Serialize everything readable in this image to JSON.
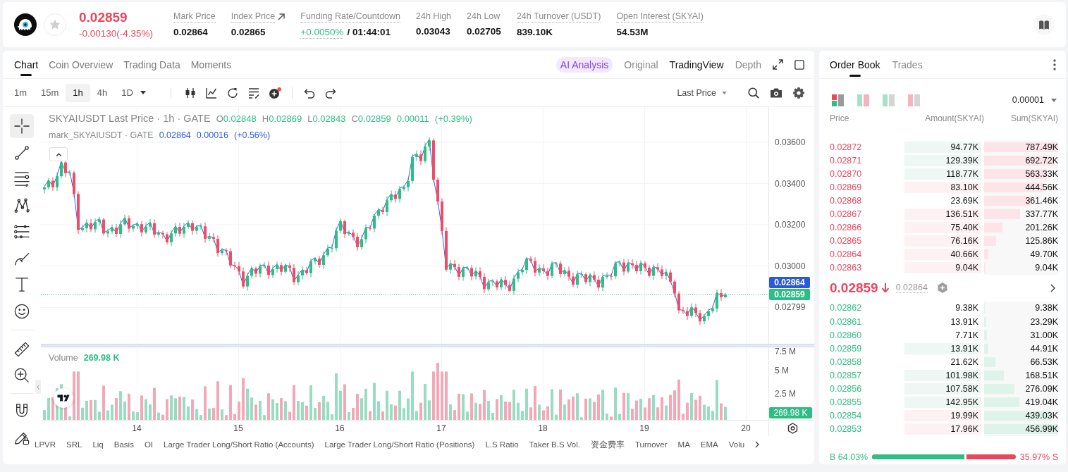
{
  "header": {
    "falling": true,
    "price": "0.02859",
    "change": "-0.00130(-4.35%)",
    "favorite": false,
    "stats": [
      {
        "kind": "plain",
        "label": "Mark Price",
        "tooltip": true,
        "value": "0.02864"
      },
      {
        "kind": "link",
        "label": "Index Price",
        "tooltip": true,
        "value": "0.02865"
      },
      {
        "kind": "funding",
        "label": "Funding Rate/Countdown",
        "tooltip": true,
        "rate": "+0.0050%",
        "countdown": "/ 01:44:01"
      },
      {
        "kind": "plain",
        "label": "24h High",
        "tooltip": false,
        "value": "0.03043"
      },
      {
        "kind": "plain",
        "label": "24h Low",
        "tooltip": false,
        "value": "0.02705"
      },
      {
        "kind": "plain",
        "label": "24h Turnover (USDT)",
        "tooltip": true,
        "value": "839.10K"
      },
      {
        "kind": "plain",
        "label": "Open Interest (SKYAI)",
        "tooltip": true,
        "value": "54.53M"
      }
    ]
  },
  "chart_panel": {
    "tabs": [
      {
        "label": "Chart",
        "selected": true
      },
      {
        "label": "Coin Overview",
        "selected": false
      },
      {
        "label": "Trading Data",
        "selected": false
      },
      {
        "label": "Moments",
        "selected": false
      }
    ],
    "views": [
      {
        "kind": "ai",
        "label": "AI Analysis",
        "selected": false
      },
      {
        "kind": "text",
        "label": "Original",
        "selected": false
      },
      {
        "kind": "text",
        "label": "TradingView",
        "selected": true
      },
      {
        "kind": "text",
        "label": "Depth",
        "selected": false
      }
    ],
    "intervals": [
      {
        "kind": "button",
        "label": "1m",
        "selected": false
      },
      {
        "kind": "button",
        "label": "15m",
        "selected": false
      },
      {
        "kind": "button",
        "label": "1h",
        "selected": true
      },
      {
        "kind": "button",
        "label": "4h",
        "selected": false
      },
      {
        "kind": "menu",
        "label": "1D",
        "selected": false
      }
    ],
    "price_source": "Last Price",
    "tools": [
      {
        "kind": "crosshair",
        "selected": true
      },
      {
        "kind": "trend_line",
        "selected": false
      },
      {
        "kind": "horizontal_lines",
        "selected": false
      },
      {
        "kind": "pattern",
        "selected": false
      },
      {
        "kind": "fib",
        "selected": false
      },
      {
        "kind": "brush",
        "selected": false
      },
      {
        "kind": "text",
        "selected": false
      },
      {
        "kind": "emoji",
        "selected": false
      },
      {
        "kind": "ruler",
        "selected": false
      },
      {
        "kind": "zoom",
        "selected": false
      },
      {
        "kind": "magnet",
        "selected": false
      },
      {
        "kind": "lock_pencil",
        "selected": false
      }
    ],
    "legend": {
      "title": "SKYAIUSDT Last Price · 1h · GATE",
      "rising": true,
      "ohlc": [
        {
          "key": "O",
          "value": "0.02848"
        },
        {
          "key": "H",
          "value": "0.02869"
        },
        {
          "key": "L",
          "value": "0.02843"
        },
        {
          "key": "C",
          "value": "0.02859"
        }
      ],
      "change": "0.00011",
      "change_pct": "(+0.39%)"
    },
    "mark_legend": {
      "title": "mark_SKYAIUSDT · GATE",
      "value": "0.02864",
      "change": "0.00016",
      "change_pct": "(+0.56%)"
    },
    "price_axis": [
      "0.03600",
      "0.03400",
      "0.03200",
      "0.03000",
      "0.02799"
    ],
    "price_tags": [
      {
        "kind": "mark",
        "value": "0.02864"
      },
      {
        "kind": "last",
        "value": "0.02859"
      }
    ],
    "volume": {
      "title": "Volume",
      "value": "269.98 K",
      "axis": [
        "7.5 M",
        "5 M",
        "2.5 M"
      ],
      "tag": "269.98 K"
    },
    "time_axis": [
      "14",
      "15",
      "16",
      "17",
      "18",
      "19",
      "20"
    ],
    "indicators": [
      "LPVR",
      "SRL",
      "Liq",
      "Basis",
      "OI",
      "Large Trader Long/Short Ratio (Accounts)",
      "Large Trader Long/Short Ratio (Positions)",
      "L.S Ratio",
      "Taker B.S Vol.",
      "资金费率",
      "Turnover",
      "MA",
      "EMA",
      "Volu"
    ]
  },
  "order_book": {
    "tabs": [
      {
        "label": "Order Book",
        "selected": true
      },
      {
        "label": "Trades",
        "selected": false
      }
    ],
    "views": [
      {
        "kind": "combined",
        "selected": true
      },
      {
        "kind": "split",
        "selected": false
      },
      {
        "kind": "bids",
        "selected": false
      },
      {
        "kind": "asks",
        "selected": false
      }
    ],
    "precision": "0.00001",
    "columns": [
      "Price",
      "Amount(SKYAI)",
      "Sum(SKYAI)"
    ],
    "asks": [
      {
        "kind": "buy",
        "price": "0.02872",
        "amount": "94.77K",
        "sum": "787.49K",
        "level": 1
      },
      {
        "kind": "buy",
        "price": "0.02871",
        "amount": "129.39K",
        "sum": "692.72K",
        "level": 0.96
      },
      {
        "kind": "buy",
        "price": "0.02870",
        "amount": "118.77K",
        "sum": "563.33K",
        "level": 0.85
      },
      {
        "kind": "sell",
        "price": "0.02869",
        "amount": "83.10K",
        "sum": "444.56K",
        "level": 0.8
      },
      {
        "kind": "plain",
        "price": "0.02868",
        "amount": "23.69K",
        "sum": "361.46K",
        "level": 0.64
      },
      {
        "kind": "sell",
        "price": "0.02867",
        "amount": "136.51K",
        "sum": "337.77K",
        "level": 0.49
      },
      {
        "kind": "sell",
        "price": "0.02866",
        "amount": "75.40K",
        "sum": "201.26K",
        "level": 0.25
      },
      {
        "kind": "sell",
        "price": "0.02865",
        "amount": "76.16K",
        "sum": "125.86K",
        "level": 0.16
      },
      {
        "kind": "sell",
        "price": "0.02864",
        "amount": "40.66K",
        "sum": "49.70K",
        "level": 0.06
      },
      {
        "kind": "sell",
        "price": "0.02863",
        "amount": "9.04K",
        "sum": "9.04K",
        "level": 0.015
      }
    ],
    "last": {
      "price": "0.02859",
      "falling": true,
      "mark": "0.02864"
    },
    "bids": [
      {
        "kind": "plain",
        "price": "0.02862",
        "amount": "9.38K",
        "sum": "9.38K",
        "level": 0.01
      },
      {
        "kind": "plain",
        "price": "0.02861",
        "amount": "13.91K",
        "sum": "23.29K",
        "level": 0.026
      },
      {
        "kind": "plain",
        "price": "0.02860",
        "amount": "7.71K",
        "sum": "31.00K",
        "level": 0.04
      },
      {
        "kind": "buy",
        "price": "0.02859",
        "amount": "13.91K",
        "sum": "44.91K",
        "level": 0.055
      },
      {
        "kind": "plain",
        "price": "0.02858",
        "amount": "21.62K",
        "sum": "66.53K",
        "level": 0.15
      },
      {
        "kind": "buy",
        "price": "0.02857",
        "amount": "101.98K",
        "sum": "168.51K",
        "level": 0.27
      },
      {
        "kind": "buy",
        "price": "0.02856",
        "amount": "107.58K",
        "sum": "276.09K",
        "level": 0.41
      },
      {
        "kind": "buy",
        "price": "0.02855",
        "amount": "142.95K",
        "sum": "419.04K",
        "level": 0.48
      },
      {
        "kind": "sell",
        "price": "0.02854",
        "amount": "19.99K",
        "sum": "439.03K",
        "level": 0.91
      },
      {
        "kind": "sell",
        "price": "0.02853",
        "amount": "17.96K",
        "sum": "456.99K",
        "level": 1
      }
    ],
    "ratio": {
      "buy": "B 64.03%",
      "sell": "35.97% S",
      "level": 0.6403
    }
  }
}
